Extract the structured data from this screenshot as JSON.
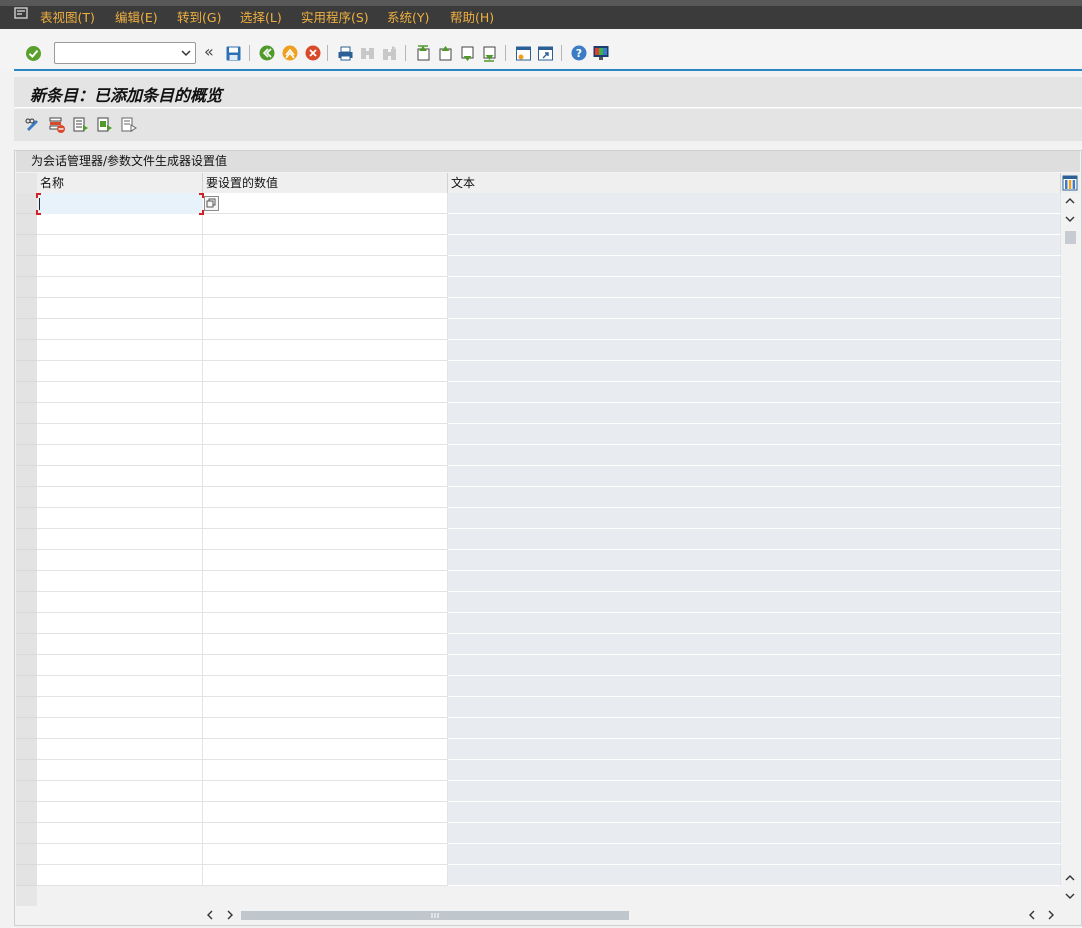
{
  "menu": {
    "items": [
      {
        "label": "表视图(T)"
      },
      {
        "label": "编辑(E)"
      },
      {
        "label": "转到(G)"
      },
      {
        "label": "选择(L)"
      },
      {
        "label": "实用程序(S)"
      },
      {
        "label": "系统(Y)"
      },
      {
        "label": "帮助(H)"
      }
    ]
  },
  "toolbar": {
    "command_field_value": "",
    "back_symbol": "«"
  },
  "screen": {
    "title": "新条目：已添加条目的概览"
  },
  "table": {
    "title": "为会话管理器/参数文件生成器设置值",
    "columns": [
      {
        "label": "名称"
      },
      {
        "label": "要设置的数值"
      },
      {
        "label": "文本"
      }
    ],
    "rows": 34
  },
  "colors": {
    "menu_text": "#f0b040",
    "accent_line": "#2a86c4",
    "menubar_bg": "#3b3b3b"
  }
}
